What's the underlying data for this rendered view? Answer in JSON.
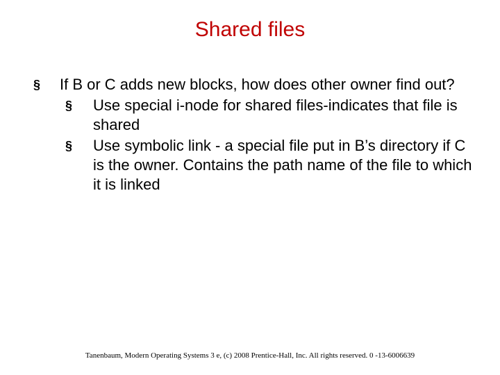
{
  "title": "Shared files",
  "bullets": {
    "lvl1": {
      "glyph": "§",
      "text": "If B or C adds new blocks, how does other owner find out?"
    },
    "lvl2": [
      {
        "glyph": "§",
        "text": "Use special i-node for shared files-indicates that file is shared"
      },
      {
        "glyph": "§",
        "text": "Use symbolic link - a special file put in B’s directory if C is the owner. Contains the path name of the file to which it is linked"
      }
    ]
  },
  "footer": "Tanenbaum, Modern Operating Systems 3 e, (c) 2008 Prentice-Hall, Inc. All rights reserved. 0 -13-6006639"
}
